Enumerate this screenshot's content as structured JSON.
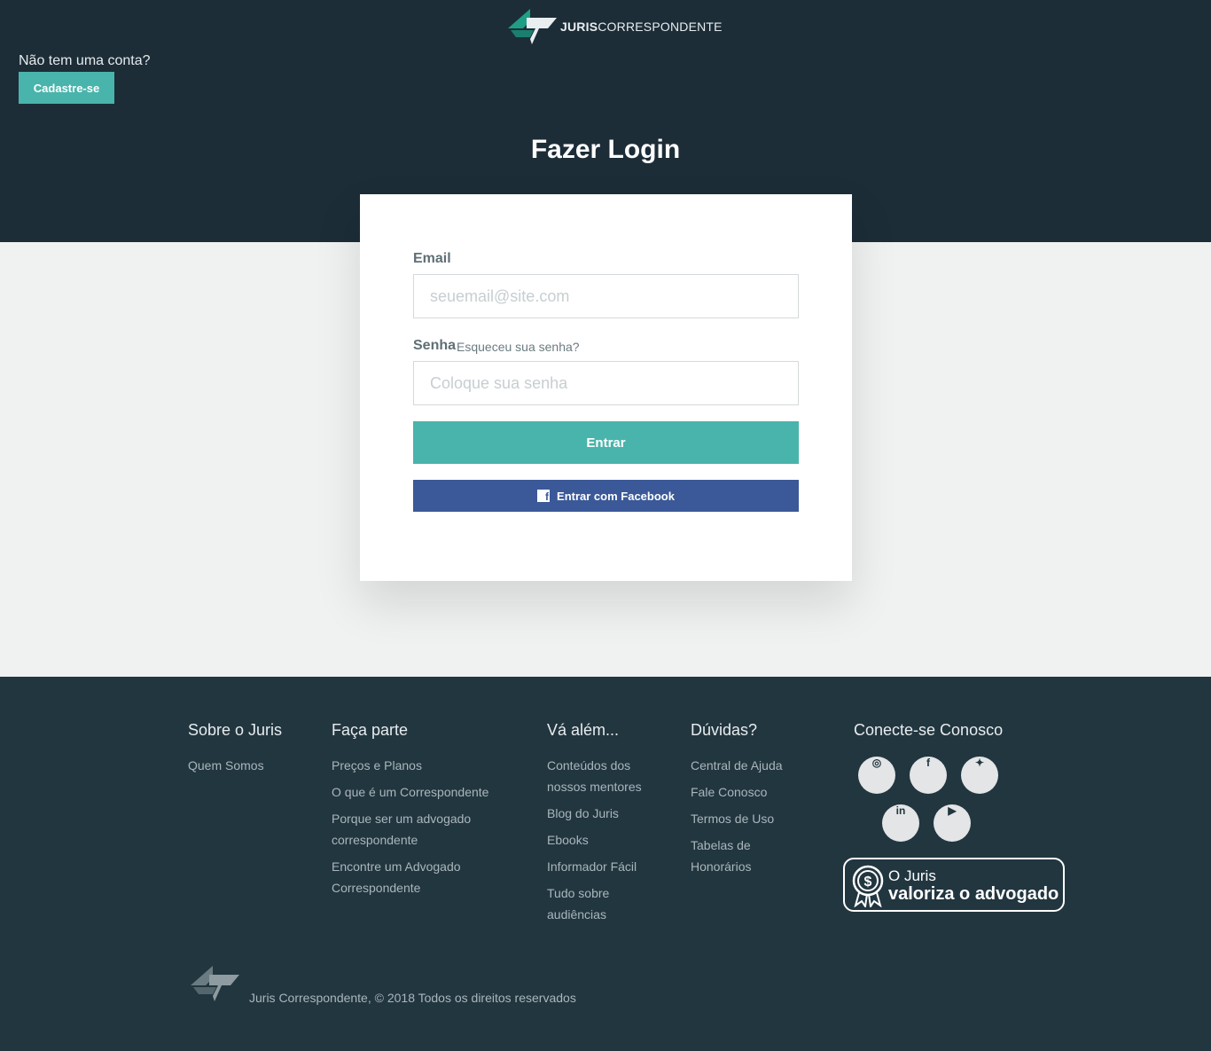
{
  "brand": {
    "name_bold": "JURIS",
    "name_rest": "CORRESPONDENTE",
    "logo_colors": [
      "#1f9e86",
      "#ffffff"
    ]
  },
  "header": {
    "signup_question": "Não tem uma conta?",
    "signup_button": "Cadastre-se"
  },
  "login": {
    "title": "Fazer Login",
    "email_label": "Email",
    "email_placeholder": "seuemail@site.com",
    "password_label": "Senha",
    "forgot_link": "Esqueceu sua senha?",
    "password_placeholder": "Coloque sua senha",
    "submit_button": "Entrar",
    "facebook_button": "Entrar com Facebook"
  },
  "footer": {
    "columns": [
      {
        "title": "Sobre o Juris",
        "links": [
          "Quem Somos"
        ]
      },
      {
        "title": "Faça parte",
        "links": [
          "Preços e Planos",
          "O que é um Correspondente",
          "Porque ser um advogado correspondente",
          "Encontre um Advogado Correspondente"
        ]
      },
      {
        "title": "Vá além...",
        "links": [
          "Conteúdos dos nossos mentores",
          "Blog do Juris",
          "Ebooks",
          "Informador Fácil",
          "Tudo sobre audiências"
        ]
      },
      {
        "title": "Dúvidas?",
        "links": [
          "Central de Ajuda",
          "Fale Conosco",
          "Termos de Uso",
          "Tabelas de Honorários"
        ]
      }
    ],
    "social_title": "Conecte-se Conosco",
    "social_icons": [
      "instagram-icon",
      "facebook-icon",
      "twitter-icon",
      "linkedin-icon",
      "youtube-icon"
    ],
    "badge_line1": "O Juris",
    "badge_line2": "valoriza o advogado",
    "copyright": "Juris Correspondente, © 2018 Todos os direitos reservados"
  },
  "colors": {
    "header_bg": "#1c2d38",
    "accent": "#49b4ab",
    "facebook": "#3b5998",
    "footer_bg": "#223640",
    "page_bg": "#f0f2f2"
  }
}
